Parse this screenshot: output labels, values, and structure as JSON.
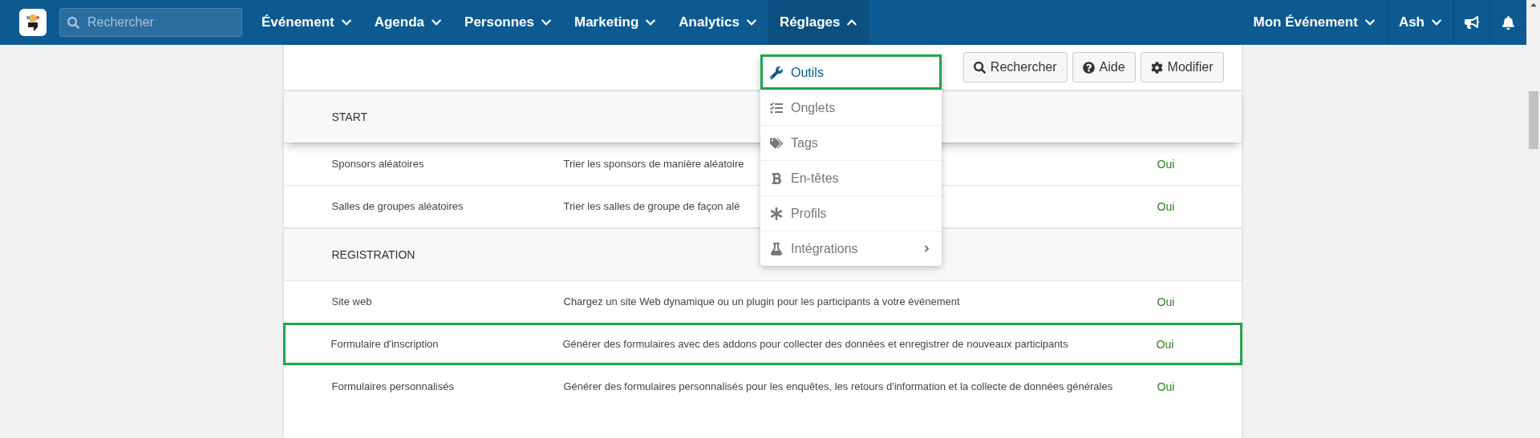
{
  "nav": {
    "search": {
      "placeholder": "Rechercher"
    },
    "menus": [
      {
        "label": "Événement",
        "expanded": false
      },
      {
        "label": "Agenda",
        "expanded": false
      },
      {
        "label": "Personnes",
        "expanded": false
      },
      {
        "label": "Marketing",
        "expanded": false
      },
      {
        "label": "Analytics",
        "expanded": false
      },
      {
        "label": "Réglages",
        "expanded": true
      }
    ],
    "right_menus": [
      {
        "label": "Mon Événement",
        "expanded": false
      },
      {
        "label": "Ash",
        "expanded": false
      }
    ]
  },
  "toolbar": {
    "buttons": [
      {
        "kind": "search",
        "label": "Rechercher"
      },
      {
        "kind": "help",
        "label": "Aide"
      },
      {
        "kind": "edit",
        "label": "Modifier"
      }
    ]
  },
  "dropdown": {
    "items": [
      {
        "kind": "wrench",
        "label": "Outils",
        "selected": true,
        "highlighted": true,
        "submenu": false
      },
      {
        "kind": "list",
        "label": "Onglets",
        "selected": false,
        "highlighted": false,
        "submenu": false
      },
      {
        "kind": "tags",
        "label": "Tags",
        "selected": false,
        "highlighted": false,
        "submenu": false
      },
      {
        "kind": "bold",
        "label": "En-têtes",
        "selected": false,
        "highlighted": false,
        "submenu": false
      },
      {
        "kind": "asterisk",
        "label": "Profils",
        "selected": false,
        "highlighted": false,
        "submenu": false
      },
      {
        "kind": "flask",
        "label": "Intégrations",
        "selected": false,
        "highlighted": false,
        "submenu": true
      }
    ]
  },
  "sections": [
    {
      "title": "START",
      "rows": [
        {
          "name": "Sponsors aléatoires",
          "description": "Trier les sponsors de manière aléatoire",
          "status": "Oui",
          "highlighted": false
        },
        {
          "name": "Salles de groupes aléatoires",
          "description": "Trier les salles de groupe de façon alé",
          "status": "Oui",
          "highlighted": false
        }
      ]
    },
    {
      "title": "REGISTRATION",
      "rows": [
        {
          "name": "Site web",
          "description": "Chargez un site Web dynamique ou un plugin pour les participants à votre événement",
          "status": "Oui",
          "highlighted": false
        },
        {
          "name": "Formulaire d'inscription",
          "description": "Générer des formulaires avec des addons pour collecter des données et enregistrer de nouveaux participants",
          "status": "Oui",
          "highlighted": true
        },
        {
          "name": "Formulaires personnalisés",
          "description": "Générer des formulaires personnalisés pour les enquêtes, les retours d'information et la collecte de données générales",
          "status": "Oui",
          "highlighted": false
        }
      ]
    }
  ]
}
